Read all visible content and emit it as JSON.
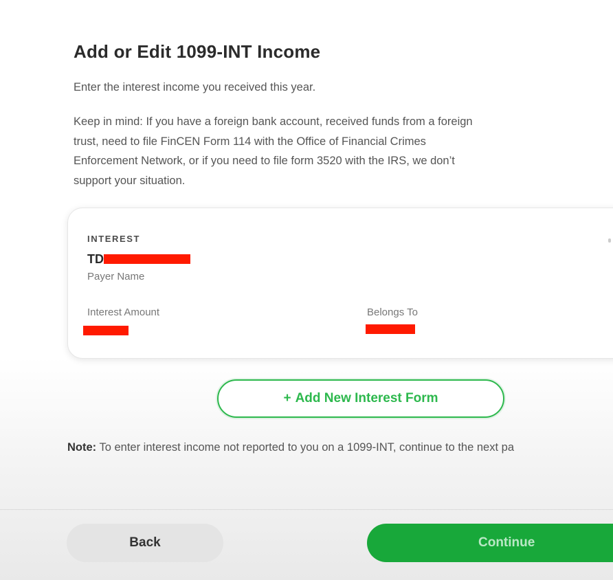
{
  "page": {
    "title": "Add or Edit 1099-INT Income",
    "intro": "Enter the interest income you received this year.",
    "warning": "Keep in mind: If you have a foreign bank account, received funds from a foreign trust, need to file FinCEN Form 114 with the Office of Financial Crimes Enforcement Network, or if you need to file form 3520 with the IRS, we don’t support your situation."
  },
  "card": {
    "eyebrow": "INTEREST",
    "payer_name_visible": "TD",
    "payer_label": "Payer Name",
    "amount_label": "Interest Amount",
    "belongs_label": "Belongs To",
    "redaction_color": "#ff1a00"
  },
  "add_form": {
    "plus": "+",
    "label": "Add New Interest Form"
  },
  "note": {
    "prefix": "Note:",
    "text": " To enter interest income not reported to you on a 1099-INT, continue to the next pa"
  },
  "footer": {
    "back_label": "Back",
    "continue_label": "Continue"
  },
  "colors": {
    "accent": "#18a83a",
    "outline_accent": "#2db84d",
    "secondary_button": "#e4e4e4"
  }
}
